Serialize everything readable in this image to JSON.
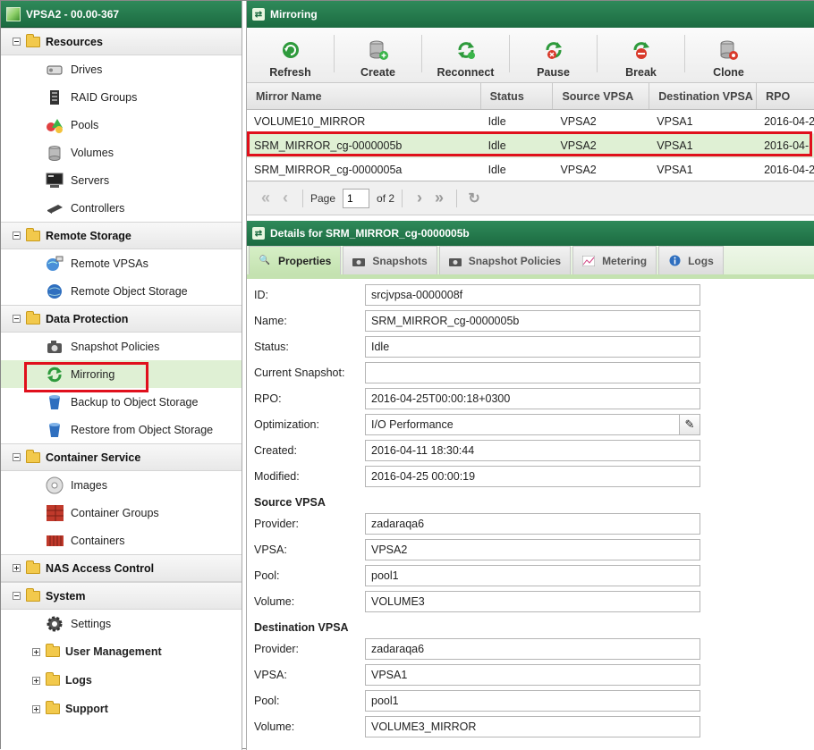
{
  "app": {
    "title": "VPSA2 - 00.00-367"
  },
  "sidebar": {
    "groups": [
      {
        "label": "Resources",
        "items": [
          "Drives",
          "RAID Groups",
          "Pools",
          "Volumes",
          "Servers",
          "Controllers"
        ]
      },
      {
        "label": "Remote Storage",
        "items": [
          "Remote VPSAs",
          "Remote Object Storage"
        ]
      },
      {
        "label": "Data Protection",
        "items": [
          "Snapshot Policies",
          "Mirroring",
          "Backup to Object Storage",
          "Restore from Object Storage"
        ]
      },
      {
        "label": "Container Service",
        "items": [
          "Images",
          "Container Groups",
          "Containers"
        ]
      },
      {
        "label": "NAS Access Control",
        "items": []
      },
      {
        "label": "System",
        "items": [
          "Settings"
        ]
      }
    ],
    "system_subgroups": [
      "User Management",
      "Logs",
      "Support"
    ],
    "selected_item": "Mirroring"
  },
  "panel": {
    "title": "Mirroring"
  },
  "toolbar": {
    "refresh": "Refresh",
    "create": "Create",
    "reconnect": "Reconnect",
    "pause": "Pause",
    "break": "Break",
    "clone": "Clone"
  },
  "grid": {
    "columns": [
      "Mirror Name",
      "Status",
      "Source VPSA",
      "Destination VPSA",
      "RPO"
    ],
    "rows": [
      [
        "VOLUME10_MIRROR",
        "Idle",
        "VPSA2",
        "VPSA1",
        "2016-04-2"
      ],
      [
        "SRM_MIRROR_cg-0000005b",
        "Idle",
        "VPSA2",
        "VPSA1",
        "2016-04-"
      ],
      [
        "SRM_MIRROR_cg-0000005a",
        "Idle",
        "VPSA2",
        "VPSA1",
        "2016-04-2"
      ]
    ],
    "selected_row": 1
  },
  "pager": {
    "page_label": "Page",
    "page_value": "1",
    "of_label": "of 2"
  },
  "details": {
    "title": "Details for SRM_MIRROR_cg-0000005b",
    "tabs": [
      "Properties",
      "Snapshots",
      "Snapshot Policies",
      "Metering",
      "Logs"
    ],
    "active_tab": "Properties",
    "fields": [
      {
        "label": "ID:",
        "value": "srcjvpsa-0000008f"
      },
      {
        "label": "Name:",
        "value": "SRM_MIRROR_cg-0000005b"
      },
      {
        "label": "Status:",
        "value": "Idle"
      },
      {
        "label": "Current Snapshot:",
        "value": ""
      },
      {
        "label": "RPO:",
        "value": "2016-04-25T00:00:18+0300"
      },
      {
        "label": "Optimization:",
        "value": "I/O Performance"
      },
      {
        "label": "Created:",
        "value": "2016-04-11 18:30:44"
      },
      {
        "label": "Modified:",
        "value": "2016-04-25 00:00:19"
      }
    ],
    "source_heading": "Source VPSA",
    "source_fields": [
      {
        "label": "Provider:",
        "value": "zadaraqa6"
      },
      {
        "label": "VPSA:",
        "value": "VPSA2"
      },
      {
        "label": "Pool:",
        "value": "pool1"
      },
      {
        "label": "Volume:",
        "value": "VOLUME3"
      }
    ],
    "dest_heading": "Destination VPSA",
    "dest_fields": [
      {
        "label": "Provider:",
        "value": "zadaraqa6"
      },
      {
        "label": "VPSA:",
        "value": "VPSA1"
      },
      {
        "label": "Pool:",
        "value": "pool1"
      },
      {
        "label": "Volume:",
        "value": "VOLUME3_MIRROR"
      }
    ]
  },
  "colors": {
    "header_green": "#1c6b41",
    "selection_green": "#dff0d4",
    "highlight_red": "#e0101c"
  }
}
